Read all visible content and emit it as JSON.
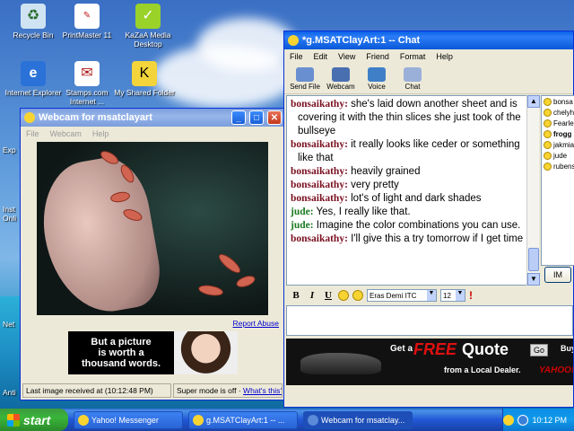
{
  "desktop": {
    "icons": [
      {
        "label": "Recycle Bin",
        "icon": "recycle-bin-icon"
      },
      {
        "label": "PrintMaster 11",
        "icon": "printmaster-icon",
        "badge": "PM\n11"
      },
      {
        "label": "KaZaA Media Desktop",
        "icon": "kazaa-icon"
      },
      {
        "label": "Internet Explorer",
        "icon": "internet-explorer-icon"
      },
      {
        "label": "Stamps.com Internet ...",
        "icon": "stamps-icon"
      },
      {
        "label": "My Shared Folder",
        "icon": "shared-folder-icon"
      }
    ],
    "edge_labels": [
      "Exp",
      "Inst Onli",
      "Net",
      "Anti"
    ]
  },
  "webcam_window": {
    "title": "Webcam for msatclayart",
    "menu": [
      "File",
      "Webcam",
      "Help"
    ],
    "report_abuse": "Report Abuse",
    "ad": {
      "line1": "But a picture",
      "line2": "is worth a",
      "line3": "thousand words."
    },
    "status": {
      "last_image": "Last image received at (10:12:48 PM)",
      "super_mode": "Super mode is off ·",
      "whats_this": "What's this?"
    }
  },
  "chat_window": {
    "title": "*g.MSATClayArt:1  -- Chat",
    "menu": [
      "File",
      "Edit",
      "View",
      "Friend",
      "Format",
      "Help"
    ],
    "toolbar": [
      {
        "label": "Send File",
        "icon": "send-file-icon",
        "color": "#6a8fd0"
      },
      {
        "label": "Webcam",
        "icon": "webcam-icon",
        "color": "#4a6fb0"
      },
      {
        "label": "Voice",
        "icon": "voice-icon",
        "color": "#3f7fc8"
      },
      {
        "label": "Chat",
        "icon": "chat-icon",
        "color": "#9ab0d8"
      }
    ],
    "messages": [
      {
        "who": "bonsaikathy:",
        "text": " she's laid down another sheet and is covering it with the thin slices she just took of the bullseye"
      },
      {
        "who": "bonsaikathy:",
        "text": " it really looks like ceder or something like that"
      },
      {
        "who": "bonsaikathy:",
        "text": " heavily grained"
      },
      {
        "who": "bonsaikathy:",
        "text": " very pretty"
      },
      {
        "who": "bonsaikathy:",
        "text": " lot's of light and dark shades"
      },
      {
        "who": "jude:",
        "text": " Yes, I really like that."
      },
      {
        "who": "jude:",
        "text": " Imagine the color combinations you can use."
      },
      {
        "who": "bonsaikathy:",
        "text": " I'll give this a try tomorrow if I get time"
      }
    ],
    "buddies": [
      "bonsa",
      "chelyh",
      "Fearle",
      "frogg",
      "jakmia",
      "jude",
      "rubens"
    ],
    "im_button": "IM",
    "format": {
      "bold": "B",
      "italic": "I",
      "underline": "U",
      "font": "Eras Demi ITC",
      "size": "12"
    },
    "ad": {
      "get": "Get a",
      "free": "FREE",
      "quote": "Quote",
      "go": "Go",
      "buy": "Buy",
      "dealer": "from a Local Dealer.",
      "yahoo": "YAHOO!"
    }
  },
  "taskbar": {
    "start": "start",
    "tasks": [
      {
        "label": "Yahoo! Messenger",
        "active": false
      },
      {
        "label": "g.MSATClayArt:1 -- ...",
        "active": false
      },
      {
        "label": "Webcam for msatclay...",
        "active": true
      }
    ],
    "clock": "10:12 PM"
  }
}
